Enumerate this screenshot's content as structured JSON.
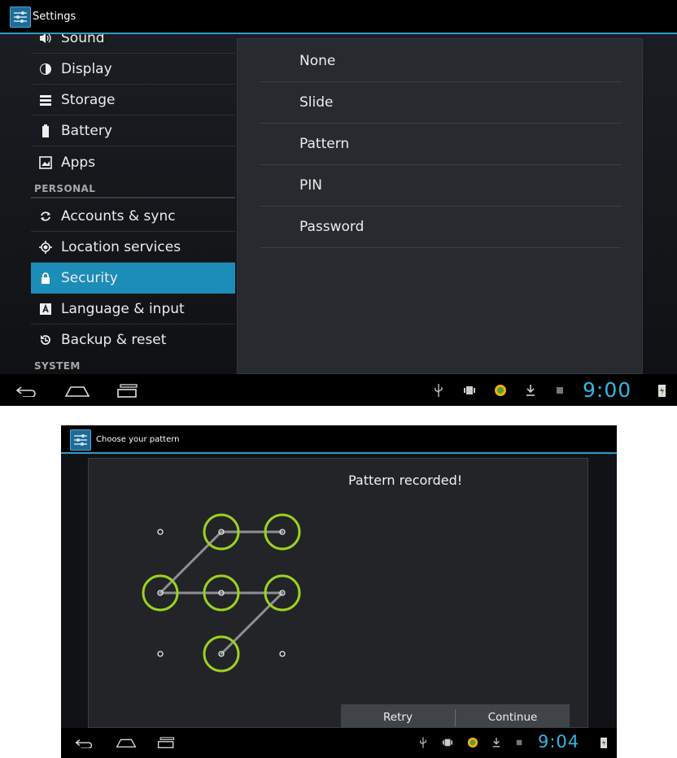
{
  "colors": {
    "accent": "#2f9cc9",
    "selected": "#1c8cb8",
    "pattern_ring": "#9bd21f",
    "clock": "#36b5e5"
  },
  "screen1": {
    "title": "Settings",
    "sidebar": {
      "items": [
        {
          "label": "Sound",
          "icon": "speaker-icon"
        },
        {
          "label": "Display",
          "icon": "brightness-icon"
        },
        {
          "label": "Storage",
          "icon": "storage-icon"
        },
        {
          "label": "Battery",
          "icon": "battery-icon"
        },
        {
          "label": "Apps",
          "icon": "apps-icon"
        }
      ],
      "personal_header": "PERSONAL",
      "personal_items": [
        {
          "label": "Accounts & sync",
          "icon": "sync-icon"
        },
        {
          "label": "Location services",
          "icon": "location-icon"
        },
        {
          "label": "Security",
          "icon": "lock-icon",
          "selected": true
        },
        {
          "label": "Language & input",
          "icon": "keyboard-icon"
        },
        {
          "label": "Backup & reset",
          "icon": "backup-icon"
        }
      ],
      "system_header": "SYSTEM"
    },
    "screen_lock_options": [
      "None",
      "Slide",
      "Pattern",
      "PIN",
      "Password"
    ],
    "status": {
      "time": "9:00"
    }
  },
  "screen2": {
    "title": "Choose your pattern",
    "header": "Pattern recorded!",
    "pattern": {
      "grid": "3x3",
      "selected_dots": [
        2,
        3,
        4,
        5,
        6,
        8
      ],
      "sequence": [
        3,
        2,
        4,
        5,
        6,
        8
      ]
    },
    "buttons": {
      "retry": "Retry",
      "continue": "Continue"
    },
    "status": {
      "time": "9:04"
    }
  }
}
